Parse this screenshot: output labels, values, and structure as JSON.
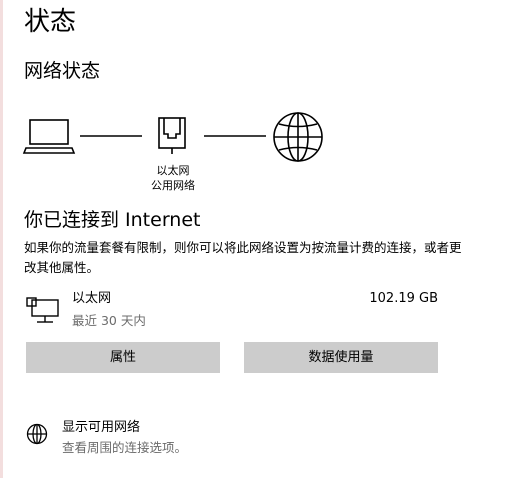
{
  "page": {
    "title": "状态",
    "section_title": "网络状态"
  },
  "diagram": {
    "computer_icon": "laptop-icon",
    "adapter_icon": "ethernet-adapter-icon",
    "internet_icon": "globe-icon",
    "adapter_name": "以太网",
    "adapter_network": "公用网络"
  },
  "connection": {
    "status": "你已连接到 Internet",
    "description": "如果你的流量套餐有限制，则你可以将此网络设置为按流量计费的连接，或者更改其他属性。"
  },
  "ethernet": {
    "icon": "ethernet-icon",
    "name": "以太网",
    "period": "最近 30 天内",
    "usage": "102.19 GB"
  },
  "buttons": {
    "properties": "属性",
    "data_usage": "数据使用量"
  },
  "available_networks": {
    "icon": "globe-icon",
    "title": "显示可用网络",
    "description": "查看周围的连接选项。"
  },
  "colors": {
    "button_bg": "#cccccc",
    "secondary_text": "#6b6b6b",
    "text": "#000000",
    "left_edge": "#f3dede"
  }
}
